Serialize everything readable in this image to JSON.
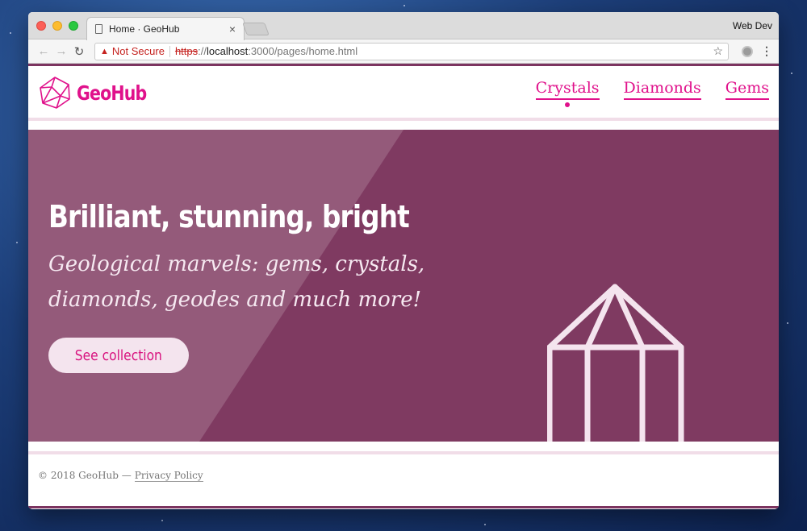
{
  "browser": {
    "tab_title": "Home · GeoHub",
    "tab_close": "×",
    "profile_name": "Web Dev",
    "security_label": "Not Secure",
    "url_scheme": "https",
    "url_sep": "://",
    "url_host": "localhost",
    "url_path": ":3000/pages/home.html",
    "back_icon": "←",
    "forward_icon": "→",
    "reload_icon": "↻",
    "bookmark_icon": "☆",
    "menu_icon": "⋮",
    "warning_icon": "▲"
  },
  "site": {
    "logo_text": "GeoHub",
    "nav": [
      {
        "label": "Crystals",
        "active": true
      },
      {
        "label": "Diamonds",
        "active": false
      },
      {
        "label": "Gems",
        "active": false
      }
    ]
  },
  "hero": {
    "title": "Brilliant, stunning, bright",
    "subtitle": "Geological marvels: gems, crystals, diamonds, geodes and much more!",
    "cta_label": "See collection"
  },
  "footer": {
    "copyright": "© 2018 GeoHub —",
    "privacy_label": "Privacy Policy"
  },
  "colors": {
    "brand_pink": "#e0118b",
    "hero_bg": "#7f3a61",
    "accent_rule": "#7c3460"
  }
}
